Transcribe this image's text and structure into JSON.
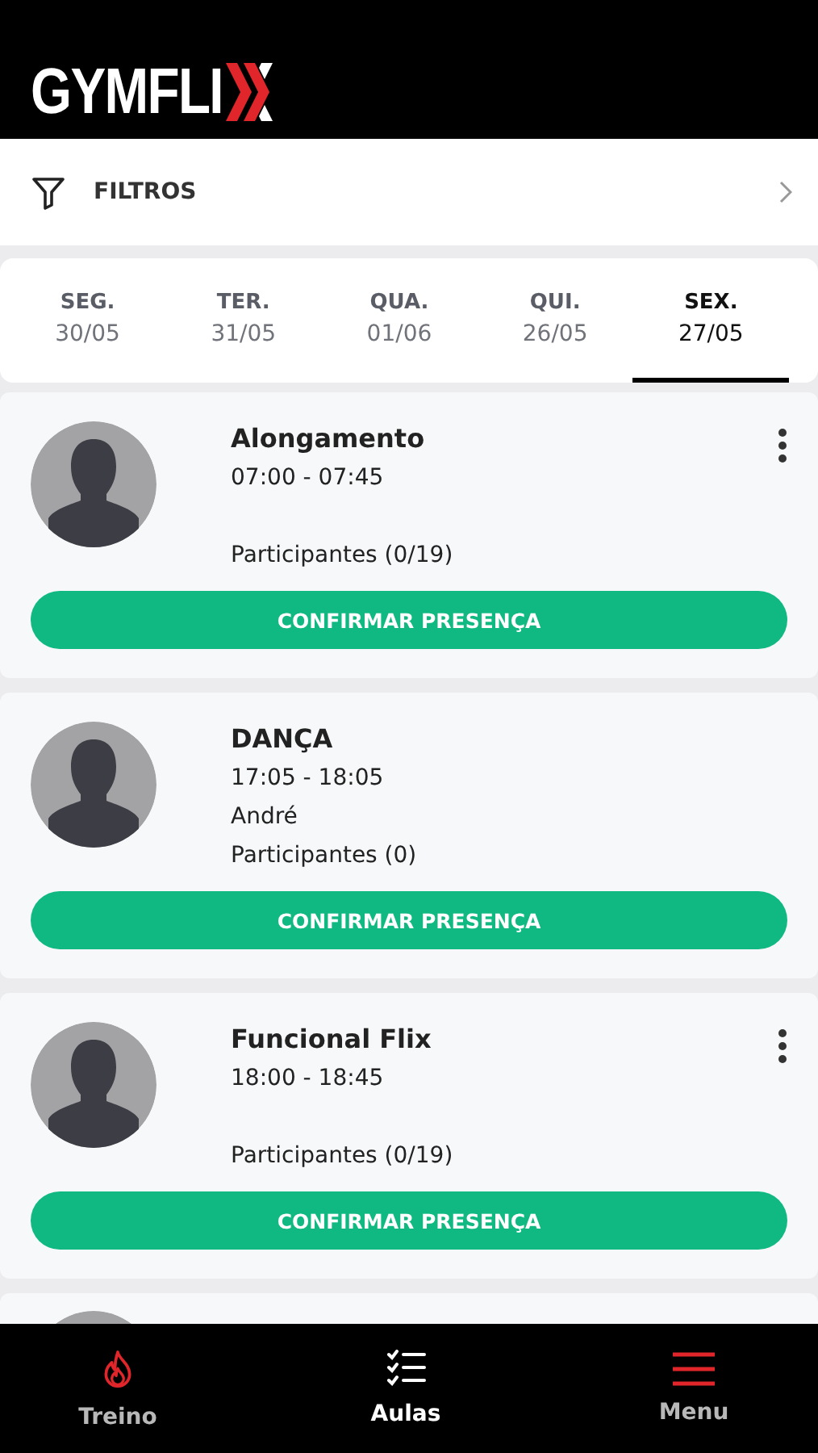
{
  "header": {
    "logo": "GYMFLI"
  },
  "filter": {
    "label": "FILTROS"
  },
  "days": [
    {
      "day": "SEG.",
      "date": "30/05",
      "selected": false
    },
    {
      "day": "TER.",
      "date": "31/05",
      "selected": false
    },
    {
      "day": "QUA.",
      "date": "01/06",
      "selected": false
    },
    {
      "day": "QUI.",
      "date": "26/05",
      "selected": false
    },
    {
      "day": "SEX.",
      "date": "27/05",
      "selected": true
    }
  ],
  "classes": [
    {
      "kind": "full",
      "title": "Alongamento",
      "time": "07:00 - 07:45",
      "participants": "Participantes (0/19)",
      "button": "CONFIRMAR PRESENÇA",
      "menu": true
    },
    {
      "kind": "full",
      "title": "DANÇA",
      "time": "17:05 - 18:05",
      "instructor": "André",
      "participants": "Participantes (0)",
      "button": "CONFIRMAR PRESENÇA",
      "menu": false
    },
    {
      "kind": "full",
      "title": "Funcional Flix",
      "time": "18:00 - 18:45",
      "participants": "Participantes (0/19)",
      "button": "CONFIRMAR PRESENÇA",
      "menu": true
    },
    {
      "kind": "cut"
    }
  ],
  "nav": [
    {
      "label": "Treino",
      "kind": "flame",
      "selected": false
    },
    {
      "label": "Aulas",
      "kind": "checklist",
      "selected": true
    },
    {
      "label": "Menu",
      "kind": "lines",
      "selected": false
    }
  ]
}
